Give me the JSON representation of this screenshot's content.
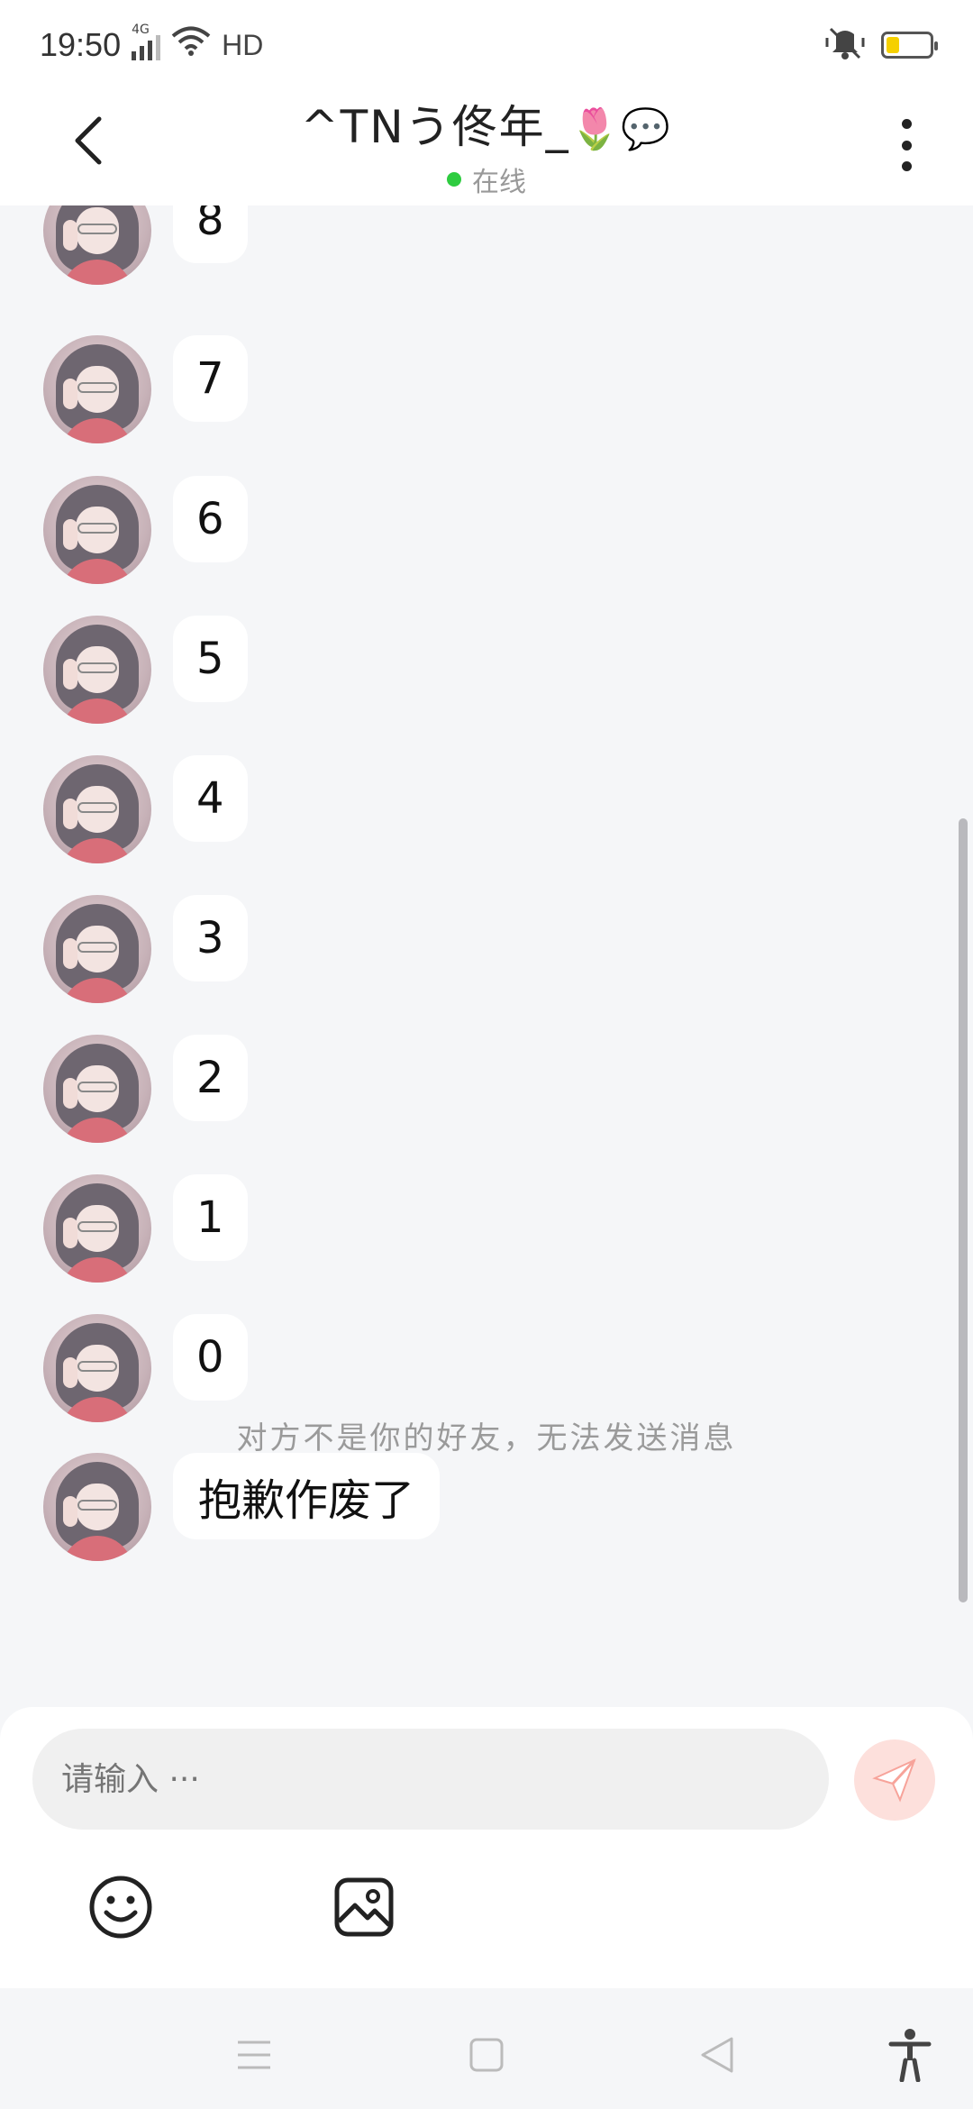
{
  "status_bar": {
    "time": "19:50",
    "network": "4G",
    "hd_label": "HD",
    "icons": [
      "signal-icon",
      "wifi-icon",
      "vibrate-off-icon",
      "battery-icon"
    ],
    "battery_color": "#f5d000"
  },
  "header": {
    "title": "^TNう佟年_",
    "title_emojis": "🌷💬",
    "online_status": "在线",
    "online_color": "#2ecc40"
  },
  "messages": [
    {
      "text": "8"
    },
    {
      "text": "7"
    },
    {
      "text": "6"
    },
    {
      "text": "5"
    },
    {
      "text": "4"
    },
    {
      "text": "3"
    },
    {
      "text": "2"
    },
    {
      "text": "1"
    },
    {
      "text": "0"
    },
    {
      "text": "抱歉作废了"
    }
  ],
  "notice": "对方不是你的好友，无法发送消息",
  "input": {
    "placeholder": "请输入 ···"
  },
  "colors": {
    "background": "#f5f6f8",
    "send_button": "#fde0dc",
    "send_icon": "#f7a39a"
  }
}
